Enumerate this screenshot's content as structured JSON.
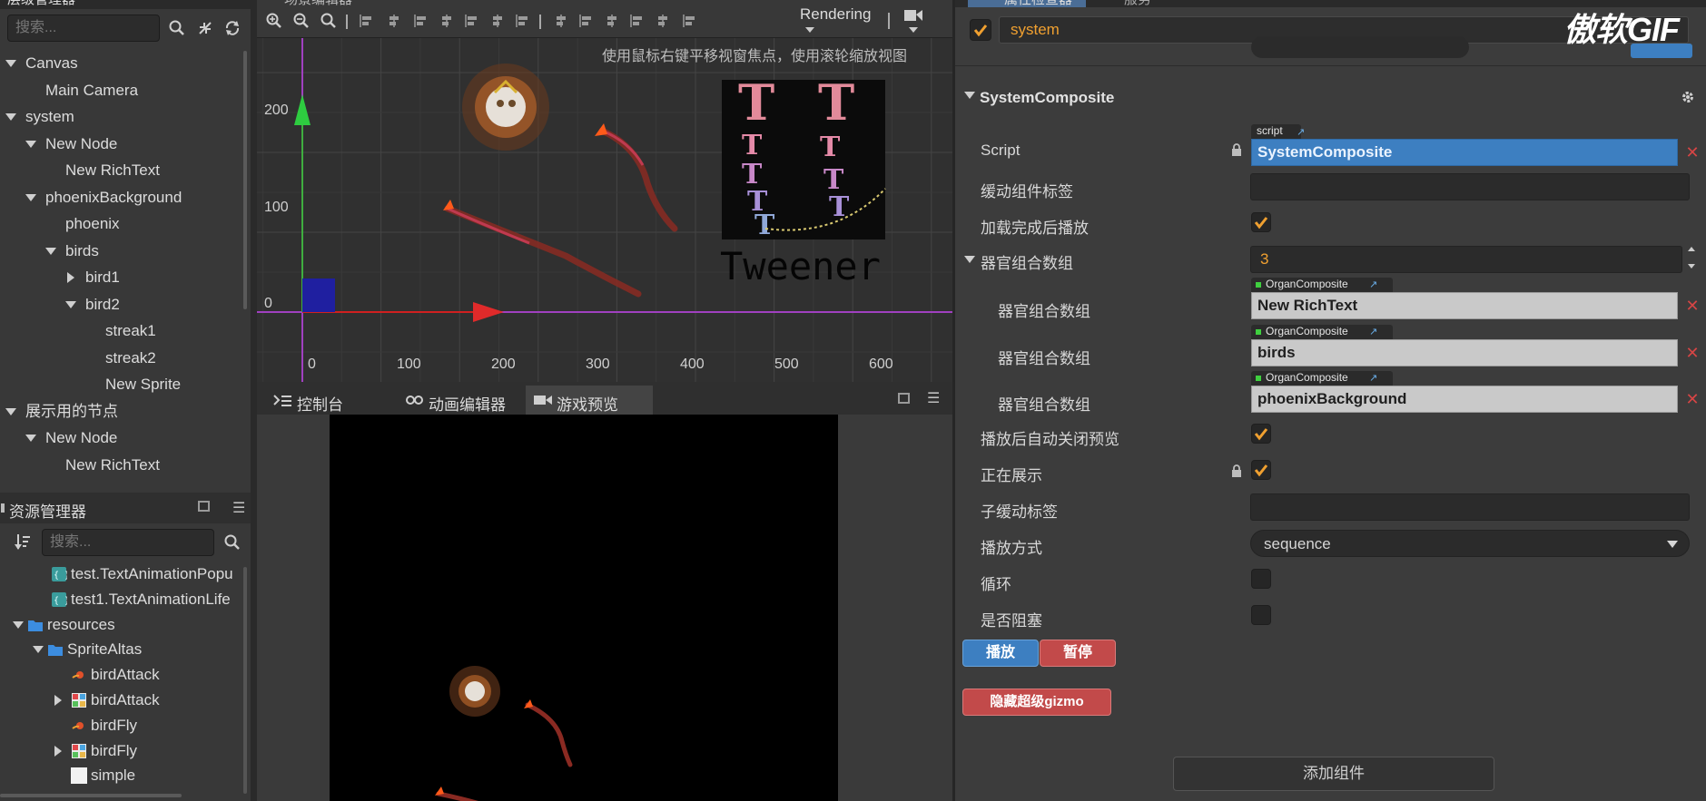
{
  "hierarchy": {
    "title": "层级管理器",
    "search_placeholder": "搜索...",
    "items": [
      {
        "label": "Canvas",
        "level": 0,
        "expanded": true
      },
      {
        "label": "Main Camera",
        "level": 1,
        "expanded": null
      },
      {
        "label": "system",
        "level": 0,
        "expanded": true
      },
      {
        "label": "New Node",
        "level": 1,
        "expanded": true
      },
      {
        "label": "New RichText",
        "level": 2,
        "expanded": null
      },
      {
        "label": "phoenixBackground",
        "level": 1,
        "expanded": true
      },
      {
        "label": "phoenix",
        "level": 2,
        "expanded": null
      },
      {
        "label": "birds",
        "level": 2,
        "expanded": true
      },
      {
        "label": "bird1",
        "level": 3,
        "expanded": false
      },
      {
        "label": "bird2",
        "level": 3,
        "expanded": true
      },
      {
        "label": "streak1",
        "level": 4,
        "expanded": null
      },
      {
        "label": "streak2",
        "level": 4,
        "expanded": null
      },
      {
        "label": "New Sprite",
        "level": 4,
        "expanded": null
      },
      {
        "label": "展示用的节点",
        "level": 0,
        "expanded": true
      },
      {
        "label": "New Node",
        "level": 1,
        "expanded": true
      },
      {
        "label": "New RichText",
        "level": 2,
        "expanded": null
      }
    ]
  },
  "assets": {
    "title": "资源管理器",
    "search_placeholder": "搜索...",
    "items": [
      {
        "label": "test.TextAnimationPopu",
        "level": 2,
        "icon": "script-icon",
        "expander": null
      },
      {
        "label": "test1.TextAnimationLife",
        "level": 2,
        "icon": "script-icon",
        "expander": null
      },
      {
        "label": "resources",
        "level": 0,
        "icon": "folder-icon",
        "expander": "open"
      },
      {
        "label": "SpriteAltas",
        "level": 1,
        "icon": "folder-icon",
        "expander": "open"
      },
      {
        "label": "birdAttack",
        "level": 3,
        "icon": "sprite-frame-icon",
        "expander": null
      },
      {
        "label": "birdAttack",
        "level": 3,
        "icon": "atlas-icon",
        "expander": "closed"
      },
      {
        "label": "birdFly",
        "level": 3,
        "icon": "sprite-frame-icon",
        "expander": null
      },
      {
        "label": "birdFly",
        "level": 3,
        "icon": "atlas-icon",
        "expander": "closed"
      },
      {
        "label": "simple",
        "level": 3,
        "icon": "texture-icon",
        "expander": null
      }
    ]
  },
  "scene": {
    "title": "场景编辑器",
    "rendering_label": "Rendering",
    "hint": "使用鼠标右键平移视窗焦点，使用滚轮缩放视图",
    "y_ticks": [
      "200",
      "100",
      "0"
    ],
    "x_ticks": [
      "0",
      "100",
      "200",
      "300",
      "400",
      "500",
      "600"
    ],
    "tweener_text": "Tweener"
  },
  "bottom_tabs": [
    {
      "label": "控制台",
      "icon": "console-icon",
      "active": false
    },
    {
      "label": "动画编辑器",
      "icon": "animation-icon",
      "active": false
    },
    {
      "label": "游戏预览",
      "icon": "camera-icon",
      "active": true
    }
  ],
  "inspector": {
    "title": "属性检查器",
    "tab2": "服务",
    "node_name": "system",
    "component_title": "SystemComposite",
    "script_tag": "script",
    "script_label": "Script",
    "script_value": "SystemComposite",
    "props": {
      "cache_tag_label": "缓动组件标签",
      "play_on_load_label": "加载完成后播放",
      "organ_array_label": "器官组合数组",
      "organ_array_count": "3",
      "auto_close_label": "播放后自动关闭预览",
      "showing_label": "正在展示",
      "child_tag_label": "子缓动标签",
      "play_mode_label": "播放方式",
      "play_mode_value": "sequence",
      "loop_label": "循环",
      "blocking_label": "是否阻塞"
    },
    "organ_items": [
      {
        "label": "器官组合数组",
        "tag": "OrganComposite",
        "value": "New RichText"
      },
      {
        "label": "器官组合数组",
        "tag": "OrganComposite",
        "value": "birds"
      },
      {
        "label": "器官组合数组",
        "tag": "OrganComposite",
        "value": "phoenixBackground"
      }
    ],
    "play_button": "播放",
    "pause_button": "暂停",
    "hide_gizmo_button": "隐藏超级gizmo",
    "add_component_button": "添加组件",
    "checkbox_states": {
      "play_on_load": true,
      "auto_close": true,
      "showing": true,
      "loop": false,
      "blocking": false
    }
  },
  "watermark": "傲软GIF",
  "colors": {
    "accent": "#f0a030",
    "selection": "#3d7fc1",
    "danger": "#c24a4a"
  }
}
